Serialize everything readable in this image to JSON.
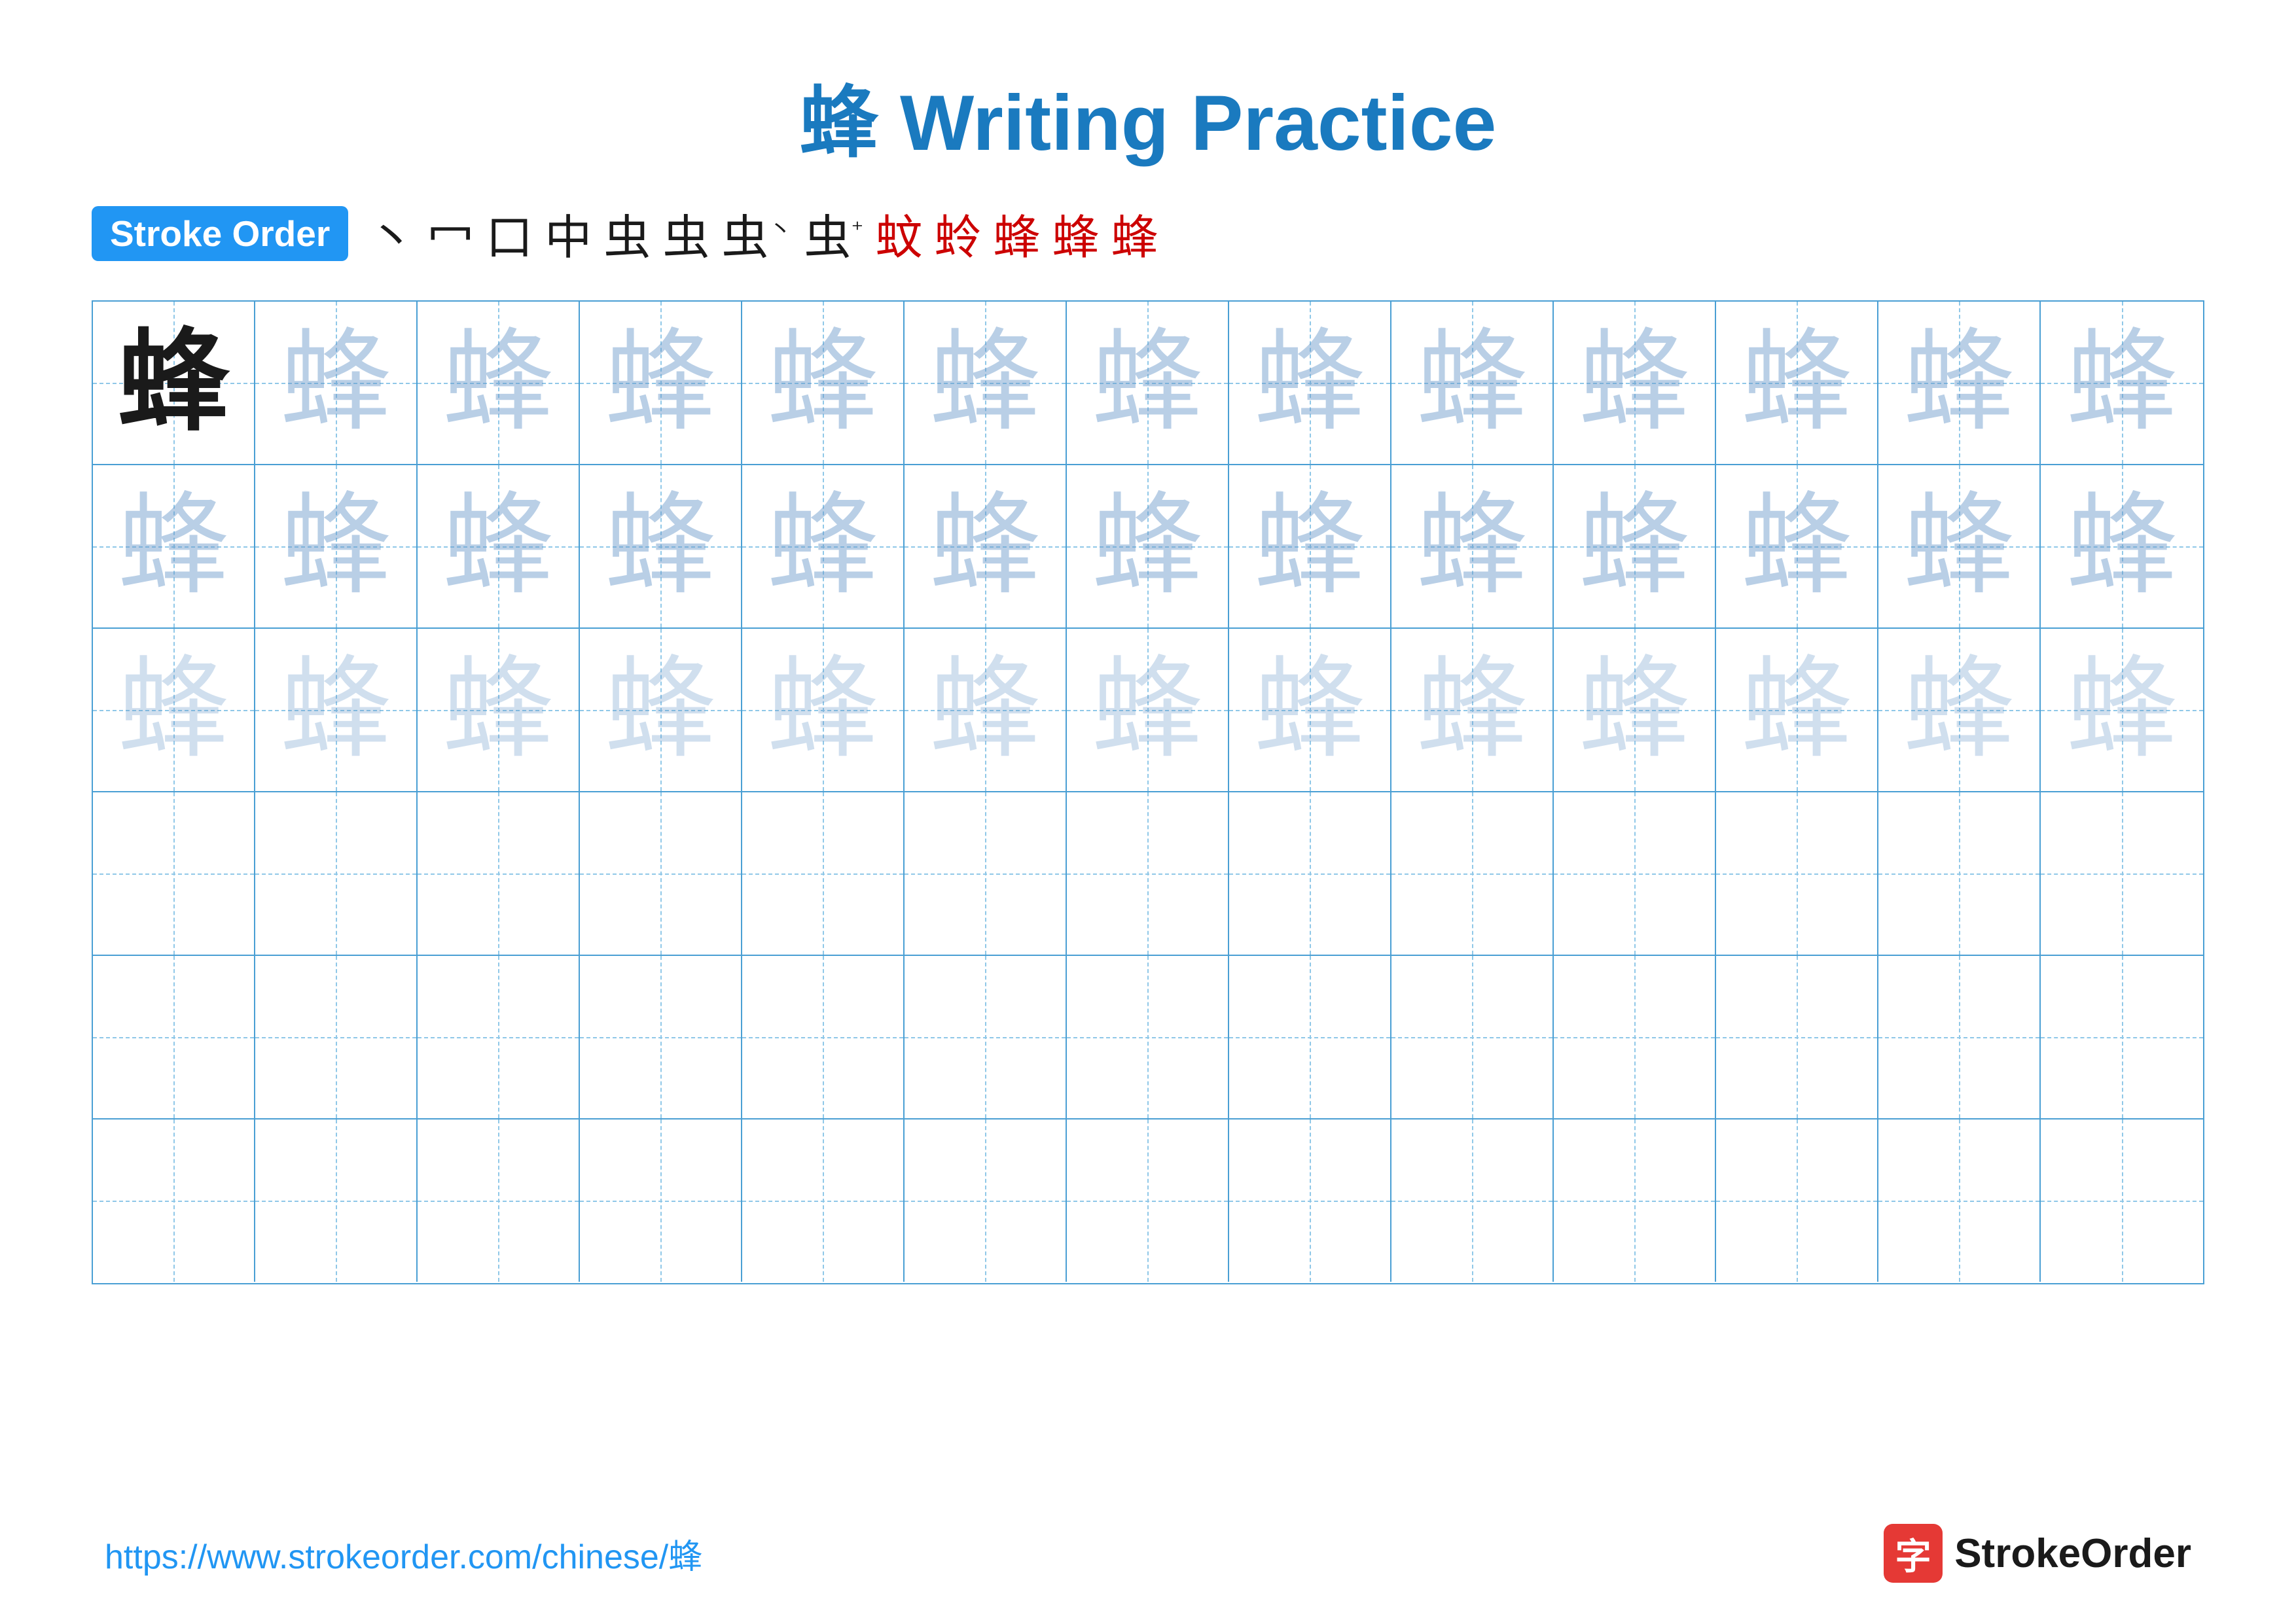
{
  "title": {
    "character": "蜂",
    "text": " Writing Practice"
  },
  "stroke_order": {
    "badge_label": "Stroke Order",
    "steps": [
      "丶",
      "冖",
      "口",
      "中",
      "虫",
      "虫",
      "虫'",
      "虫⁺",
      "蚊",
      "蛉",
      "蜂",
      "蜂",
      "蜂"
    ]
  },
  "grid": {
    "rows": 6,
    "cols": 13,
    "character": "蜂",
    "row_styles": [
      "bold+light12",
      "light1+light12",
      "light2+light12",
      "empty",
      "empty",
      "empty"
    ]
  },
  "footer": {
    "url": "https://www.strokeorder.com/chinese/蜂",
    "logo_char": "字",
    "logo_text": "StrokeOrder"
  }
}
